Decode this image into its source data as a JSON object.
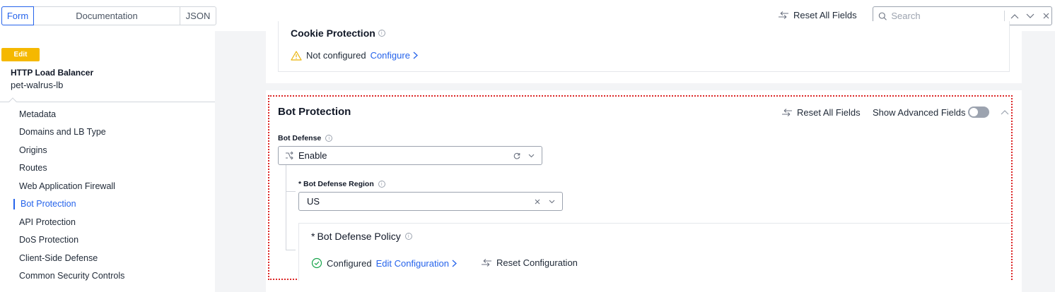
{
  "tabs": [
    {
      "label": "Form"
    },
    {
      "label": "Documentation"
    },
    {
      "label": "JSON"
    }
  ],
  "header": {
    "reset_all_label": "Reset All Fields",
    "search_placeholder": "Search"
  },
  "sidebar": {
    "edit_badge": "Edit",
    "object_type": "HTTP Load Balancer",
    "object_name": "pet-walrus-lb",
    "items": [
      {
        "label": "Metadata"
      },
      {
        "label": "Domains and LB Type"
      },
      {
        "label": "Origins"
      },
      {
        "label": "Routes"
      },
      {
        "label": "Web Application Firewall"
      },
      {
        "label": "Bot Protection"
      },
      {
        "label": "API Protection"
      },
      {
        "label": "DoS Protection"
      },
      {
        "label": "Client-Side Defense"
      },
      {
        "label": "Common Security Controls"
      }
    ]
  },
  "cookie": {
    "title": "Cookie Protection",
    "status": "Not configured",
    "configure_label": "Configure"
  },
  "bot": {
    "title": "Bot Protection",
    "reset_label": "Reset All Fields",
    "advanced_label": "Show Advanced Fields",
    "defense_label": "Bot Defense",
    "defense_value": "Enable",
    "region_label": "* Bot Defense Region",
    "region_value": "US",
    "policy_star": "*",
    "policy_title": "Bot Defense Policy",
    "policy_status": "Configured",
    "edit_config_label": "Edit Configuration",
    "reset_config_label": "Reset Configuration"
  }
}
